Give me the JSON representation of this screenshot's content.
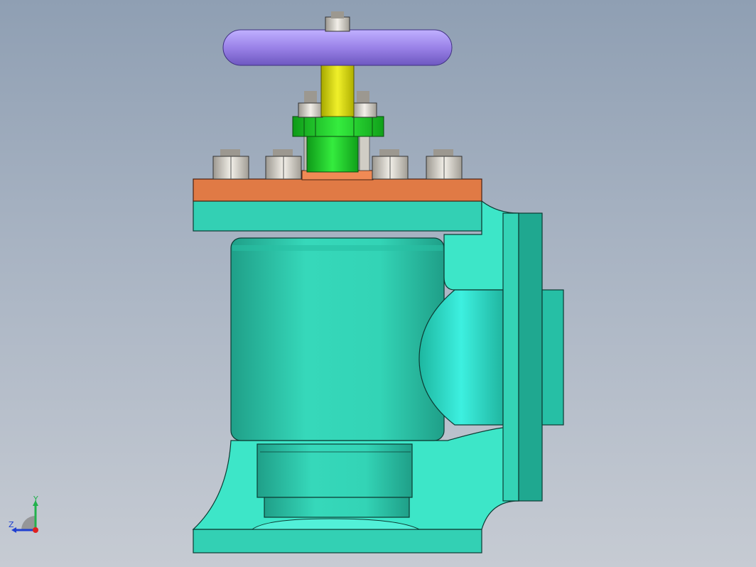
{
  "viewport": {
    "background_top": "#8f9fb3",
    "background_bottom": "#c6cbd3"
  },
  "model": {
    "part_colors": {
      "handwheel": "#9d86e6",
      "stem": "#e4e41a",
      "gland_flange": "#22d42b",
      "bonnet_flange": "#e57a45",
      "body": "#33d6b8",
      "body_dark": "#1faa92",
      "nuts": "#d8d4cc"
    },
    "icons": [
      "handwheel-icon",
      "stem-icon",
      "gland-icon",
      "bolt-icon",
      "valve-body-icon"
    ]
  },
  "triad": {
    "y_label": "Y",
    "z_label": "Z",
    "y_color": "#22b14c",
    "z_color": "#2040d0",
    "origin_color": "#e02020"
  }
}
